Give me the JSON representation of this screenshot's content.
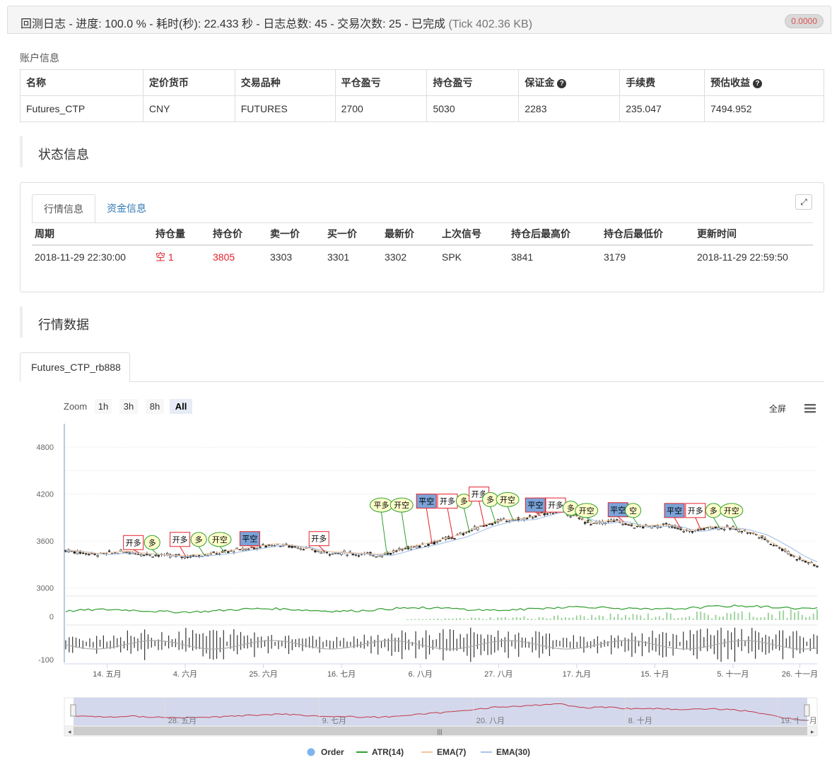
{
  "topbar": {
    "title": "回测日志 - 进度: 100.0 % - 耗时(秒): 22.433 秒 - 日志总数: 45 - 交易次数: 25 - 已完成",
    "tick": "(Tick 402.36 KB)",
    "badge": "0.0000"
  },
  "account": {
    "label": "账户信息",
    "headers": [
      "名称",
      "定价货币",
      "交易品种",
      "平仓盈亏",
      "持仓盈亏",
      "保证金",
      "手续费",
      "预估收益"
    ],
    "row": [
      "Futures_CTP",
      "CNY",
      "FUTURES",
      "2700",
      "5030",
      "2283",
      "235.047",
      "7494.952"
    ]
  },
  "sections": {
    "status_title": "状态信息",
    "market_title": "行情数据"
  },
  "status": {
    "tabs": [
      "行情信息",
      "资金信息"
    ],
    "headers": [
      "周期",
      "持仓量",
      "持仓价",
      "卖一价",
      "买一价",
      "最新价",
      "上次信号",
      "持仓后最高价",
      "持仓后最低价",
      "更新时间"
    ],
    "row": [
      "2018-11-29 22:30:00",
      "空 1",
      "3805",
      "3303",
      "3301",
      "3302",
      "SPK",
      "3841",
      "3179",
      "2018-11-29 22:59:50"
    ]
  },
  "chart_tab": "Futures_CTP_rb888",
  "chart_ui": {
    "zoom_label": "Zoom",
    "zoom_buttons": [
      "1h",
      "3h",
      "8h",
      "All"
    ],
    "zoom_active": "All",
    "fullscreen": "全屏"
  },
  "chart_data": {
    "type": "candlestick",
    "price_axis": {
      "ticks": [
        3000,
        3600,
        4200,
        4800
      ],
      "range": [
        2950,
        5100
      ]
    },
    "atr_axis": {
      "ticks": [
        0
      ]
    },
    "ema_axis": {
      "ticks": [
        -100
      ]
    },
    "x_ticks": [
      "14. 五月",
      "4. 六月",
      "25. 六月",
      "16. 七月",
      "6. 八月",
      "27. 八月",
      "17. 九月",
      "15. 十月",
      "5. 十一月",
      "26. 十一月"
    ],
    "navigator_ticks": [
      "28. 五月",
      "9. 七月",
      "20. 八月",
      "8. 十月",
      "19. 十一月"
    ],
    "price_path": [
      [
        0,
        3480
      ],
      [
        0.04,
        3430
      ],
      [
        0.08,
        3460
      ],
      [
        0.12,
        3420
      ],
      [
        0.16,
        3400
      ],
      [
        0.2,
        3440
      ],
      [
        0.24,
        3500
      ],
      [
        0.28,
        3560
      ],
      [
        0.31,
        3520
      ],
      [
        0.34,
        3460
      ],
      [
        0.38,
        3440
      ],
      [
        0.42,
        3420
      ],
      [
        0.45,
        3500
      ],
      [
        0.48,
        3560
      ],
      [
        0.52,
        3660
      ],
      [
        0.55,
        3780
      ],
      [
        0.58,
        3860
      ],
      [
        0.61,
        3880
      ],
      [
        0.64,
        3960
      ],
      [
        0.66,
        4000
      ],
      [
        0.68,
        3900
      ],
      [
        0.7,
        3820
      ],
      [
        0.73,
        3860
      ],
      [
        0.76,
        3780
      ],
      [
        0.8,
        3800
      ],
      [
        0.83,
        3720
      ],
      [
        0.86,
        3780
      ],
      [
        0.89,
        3760
      ],
      [
        0.92,
        3680
      ],
      [
        0.95,
        3520
      ],
      [
        0.97,
        3400
      ],
      [
        1,
        3280
      ]
    ],
    "signals": [
      {
        "label": "开多",
        "t": 0.09,
        "p": 3580,
        "style": "box-red"
      },
      {
        "label": "多",
        "t": 0.115,
        "p": 3580,
        "style": "oval"
      },
      {
        "label": "开多",
        "t": 0.152,
        "p": 3620,
        "style": "box-red"
      },
      {
        "label": "多",
        "t": 0.177,
        "p": 3620,
        "style": "oval"
      },
      {
        "label": "开空",
        "t": 0.205,
        "p": 3620,
        "style": "oval"
      },
      {
        "label": "平空",
        "t": 0.245,
        "p": 3630,
        "style": "box-blue"
      },
      {
        "label": "开多",
        "t": 0.337,
        "p": 3630,
        "style": "box-red"
      },
      {
        "label": "平多",
        "t": 0.42,
        "p": 4060,
        "style": "oval"
      },
      {
        "label": "开空",
        "t": 0.447,
        "p": 4060,
        "style": "oval"
      },
      {
        "label": "平空",
        "t": 0.48,
        "p": 4110,
        "style": "box-blue"
      },
      {
        "label": "开多",
        "t": 0.508,
        "p": 4110,
        "style": "box-red"
      },
      {
        "label": "多",
        "t": 0.53,
        "p": 4110,
        "style": "oval"
      },
      {
        "label": "开多",
        "t": 0.55,
        "p": 4200,
        "style": "box-red"
      },
      {
        "label": "多",
        "t": 0.565,
        "p": 4130,
        "style": "oval"
      },
      {
        "label": "开空",
        "t": 0.588,
        "p": 4130,
        "style": "oval"
      },
      {
        "label": "平空",
        "t": 0.625,
        "p": 4060,
        "style": "box-blue"
      },
      {
        "label": "开多",
        "t": 0.652,
        "p": 4060,
        "style": "box-red"
      },
      {
        "label": "多",
        "t": 0.672,
        "p": 4020,
        "style": "oval"
      },
      {
        "label": "开空",
        "t": 0.693,
        "p": 3990,
        "style": "oval"
      },
      {
        "label": "平空",
        "t": 0.735,
        "p": 4000,
        "style": "box-blue"
      },
      {
        "label": "空",
        "t": 0.755,
        "p": 3990,
        "style": "oval"
      },
      {
        "label": "平空",
        "t": 0.81,
        "p": 3990,
        "style": "box-blue"
      },
      {
        "label": "开多",
        "t": 0.838,
        "p": 3990,
        "style": "box-red"
      },
      {
        "label": "多",
        "t": 0.862,
        "p": 3990,
        "style": "oval"
      },
      {
        "label": "开空",
        "t": 0.886,
        "p": 3990,
        "style": "oval"
      }
    ],
    "legend": [
      {
        "name": "Order",
        "color": "#7cb5ec",
        "kind": "dot"
      },
      {
        "name": "ATR(14)",
        "color": "#2f9e2f",
        "kind": "line"
      },
      {
        "name": "EMA(7)",
        "color": "#f3c49a",
        "kind": "line"
      },
      {
        "name": "EMA(30)",
        "color": "#a9c4e6",
        "kind": "line"
      }
    ]
  }
}
